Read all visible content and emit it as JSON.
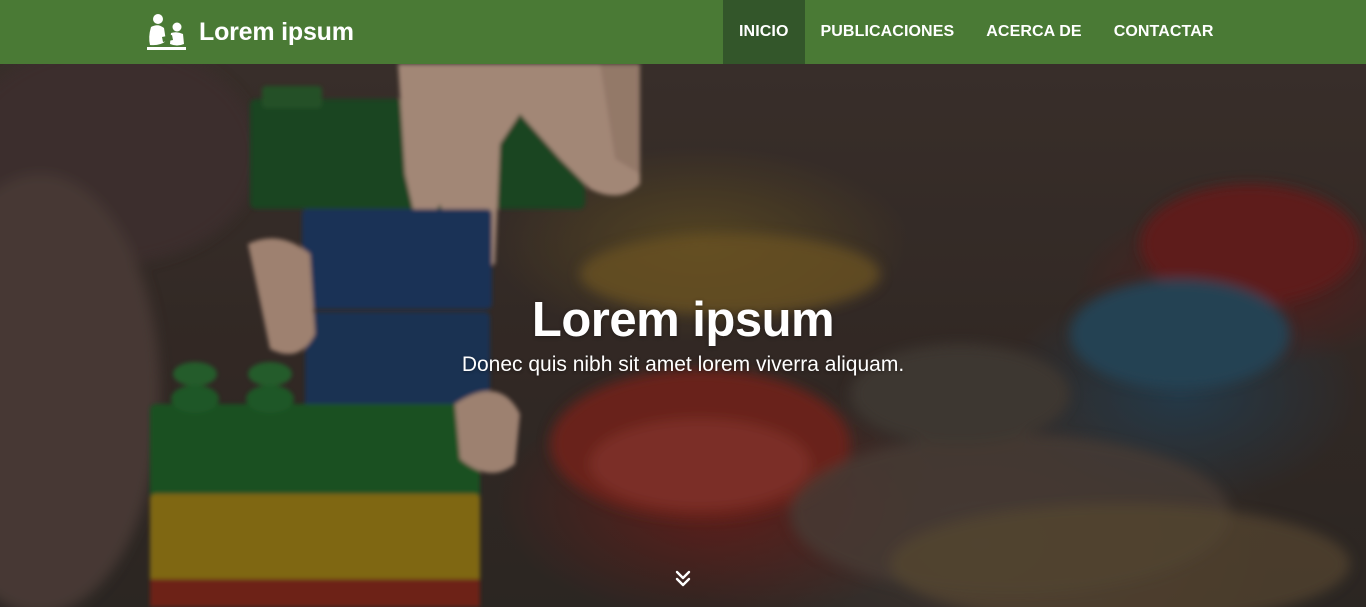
{
  "navbar": {
    "brand": {
      "text": "Lorem ipsum",
      "logo_icon": "family-reading-icon"
    },
    "items": [
      {
        "label": "INICIO",
        "active": true
      },
      {
        "label": "PUBLICACIONES",
        "active": false
      },
      {
        "label": "ACERCA DE",
        "active": false
      },
      {
        "label": "CONTACTAR",
        "active": false
      }
    ]
  },
  "hero": {
    "title": "Lorem ipsum",
    "subtitle": "Donec quis nibh sit amet lorem viverra aliquam.",
    "scroll_icon": "double-chevron-down-icon"
  },
  "colors": {
    "navbar_bg": "#4a7a35",
    "navbar_active_bg": "#33562a",
    "text": "#ffffff"
  }
}
